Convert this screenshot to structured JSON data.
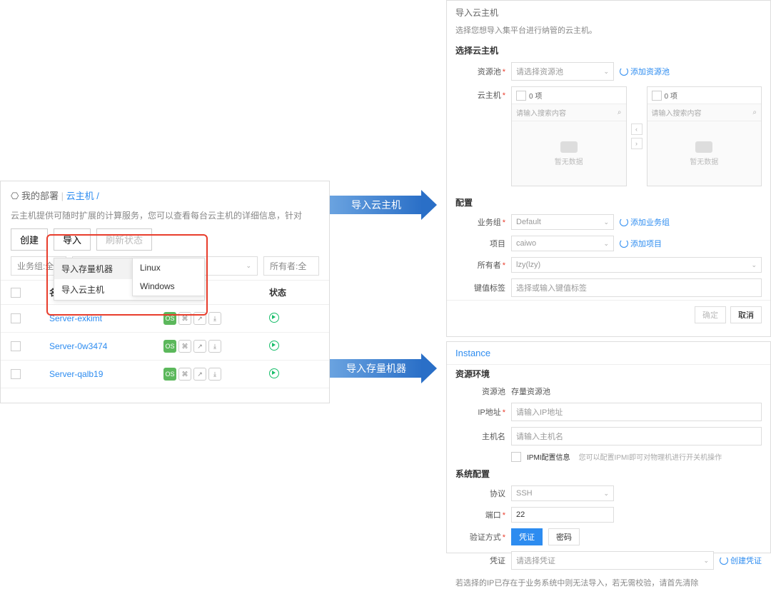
{
  "left": {
    "crumb_icon": "⎔",
    "crumb1": "我的部署",
    "crumb2": "云主机",
    "crumb3": "/",
    "desc": "云主机提供可随时扩展的计算服务，您可以查看每台云主机的详细信息，针对",
    "btn_create": "创建",
    "btn_import": "导入",
    "btn_refresh": "刷新状态",
    "filter1": "业务组:全",
    "filter2": "所有者:全",
    "menu1": "导入存量机器",
    "menu2": "导入云主机",
    "sub1": "Linux",
    "sub2": "Windows",
    "th_name": "名称",
    "th_status": "状态",
    "rows": [
      {
        "name": "Server-exkimt"
      },
      {
        "name": "Server-0w3474"
      },
      {
        "name": "Server-qalb19"
      }
    ],
    "os_badge": "OS"
  },
  "arrows": {
    "a1": "导入云主机",
    "a2": "导入存量机器"
  },
  "tr": {
    "title": "导入云主机",
    "sub": "选择您想导入集平台进行纳管的云主机。",
    "s1": "选择云主机",
    "l_pool": "资源池",
    "ph_pool": "请选择资源池",
    "lnk_pool": "添加资源池",
    "l_vm": "云主机",
    "count": "0 项",
    "ph_search": "请输入搜索内容",
    "empty": "暂无数据",
    "s2": "配置",
    "l_biz": "业务组",
    "v_biz": "Default",
    "lnk_biz": "添加业务组",
    "l_proj": "项目",
    "v_proj": "caiwo",
    "lnk_proj": "添加项目",
    "l_owner": "所有者",
    "v_owner": "lzy(lzy)",
    "l_kv": "键值标签",
    "ph_kv": "选择或输入键值标签",
    "btn_ok": "确定",
    "btn_cancel": "取消"
  },
  "br": {
    "title": "Instance",
    "s1": "资源环境",
    "l_pool": "资源池",
    "v_pool": "存量资源池",
    "l_ip": "IP地址",
    "ph_ip": "请输入IP地址",
    "l_host": "主机名",
    "ph_host": "请输入主机名",
    "l_ipmi": "IPMI配置信息",
    "hint_ipmi": "您可以配置IPMI即可对物理机进行开关机操作",
    "s2": "系统配置",
    "l_proto": "协议",
    "v_proto": "SSH",
    "l_port": "端口",
    "v_port": "22",
    "l_auth": "验证方式",
    "tag1": "凭证",
    "tag2": "密码",
    "l_cred": "凭证",
    "ph_cred": "请选择凭证",
    "lnk_cred": "创建凭证",
    "foot": "若选择的IP已存在于业务系统中则无法导入，若无需校验，请首先清除"
  }
}
